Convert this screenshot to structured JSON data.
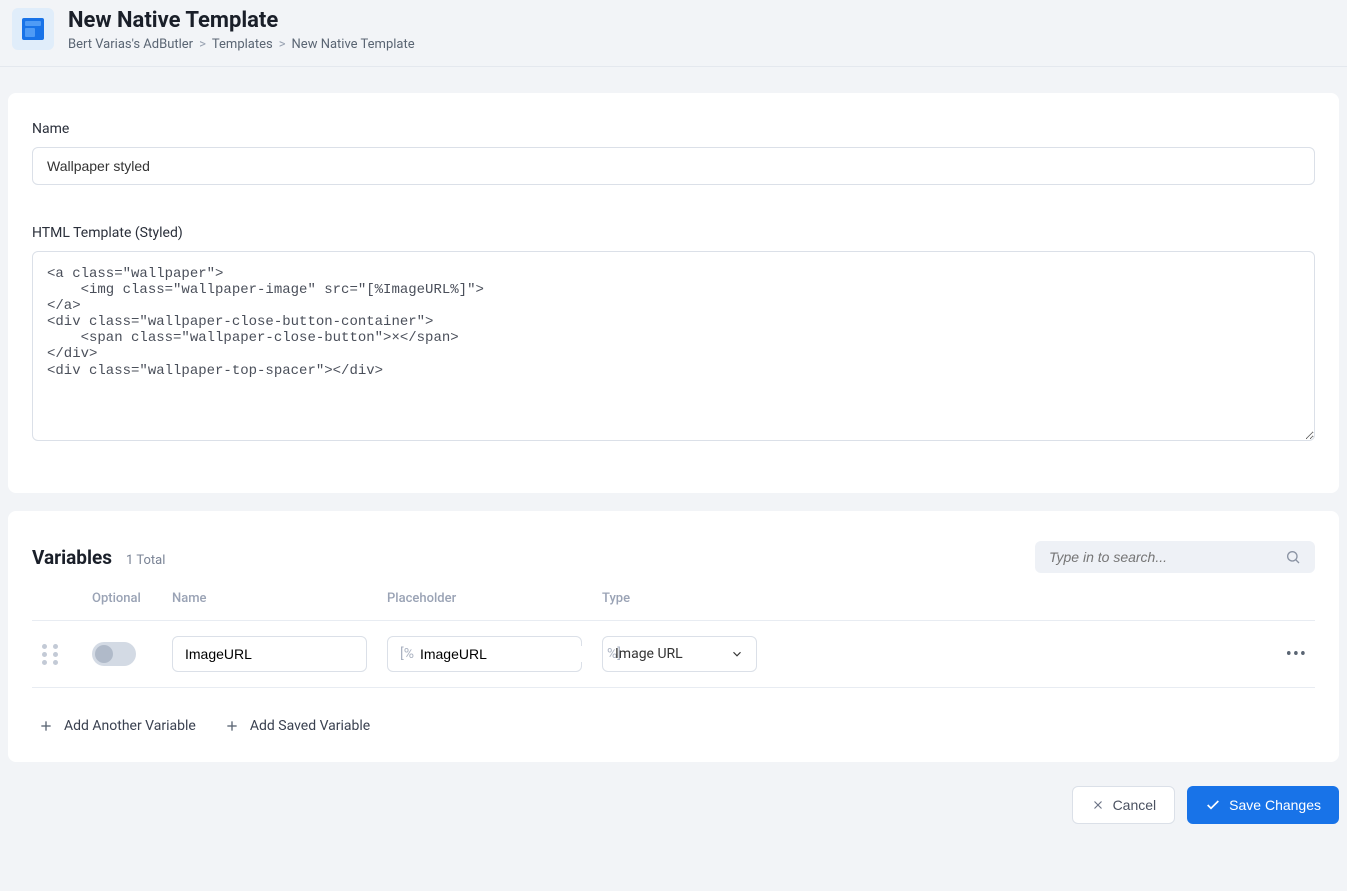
{
  "header": {
    "title": "New Native Template",
    "breadcrumb": [
      "Bert Varias's AdButler",
      "Templates",
      "New Native Template"
    ]
  },
  "form": {
    "name_label": "Name",
    "name_value": "Wallpaper styled",
    "html_label": "HTML Template (Styled)",
    "html_value": "<a class=\"wallpaper\">\n    <img class=\"wallpaper-image\" src=\"[%ImageURL%]\">\n</a>\n<div class=\"wallpaper-close-button-container\">\n    <span class=\"wallpaper-close-button\">×</span>\n</div>\n<div class=\"wallpaper-top-spacer\"></div>"
  },
  "variables": {
    "title": "Variables",
    "count_text": "1 Total",
    "search_placeholder": "Type in to search...",
    "columns": {
      "optional": "Optional",
      "name": "Name",
      "placeholder": "Placeholder",
      "type": "Type"
    },
    "rows": [
      {
        "name": "ImageURL",
        "placeholder_prefix": "[%",
        "placeholder_value": "ImageURL",
        "placeholder_suffix": "%]",
        "type": "Image URL"
      }
    ],
    "add_another": "Add Another Variable",
    "add_saved": "Add Saved Variable"
  },
  "footer": {
    "cancel": "Cancel",
    "save": "Save Changes"
  }
}
